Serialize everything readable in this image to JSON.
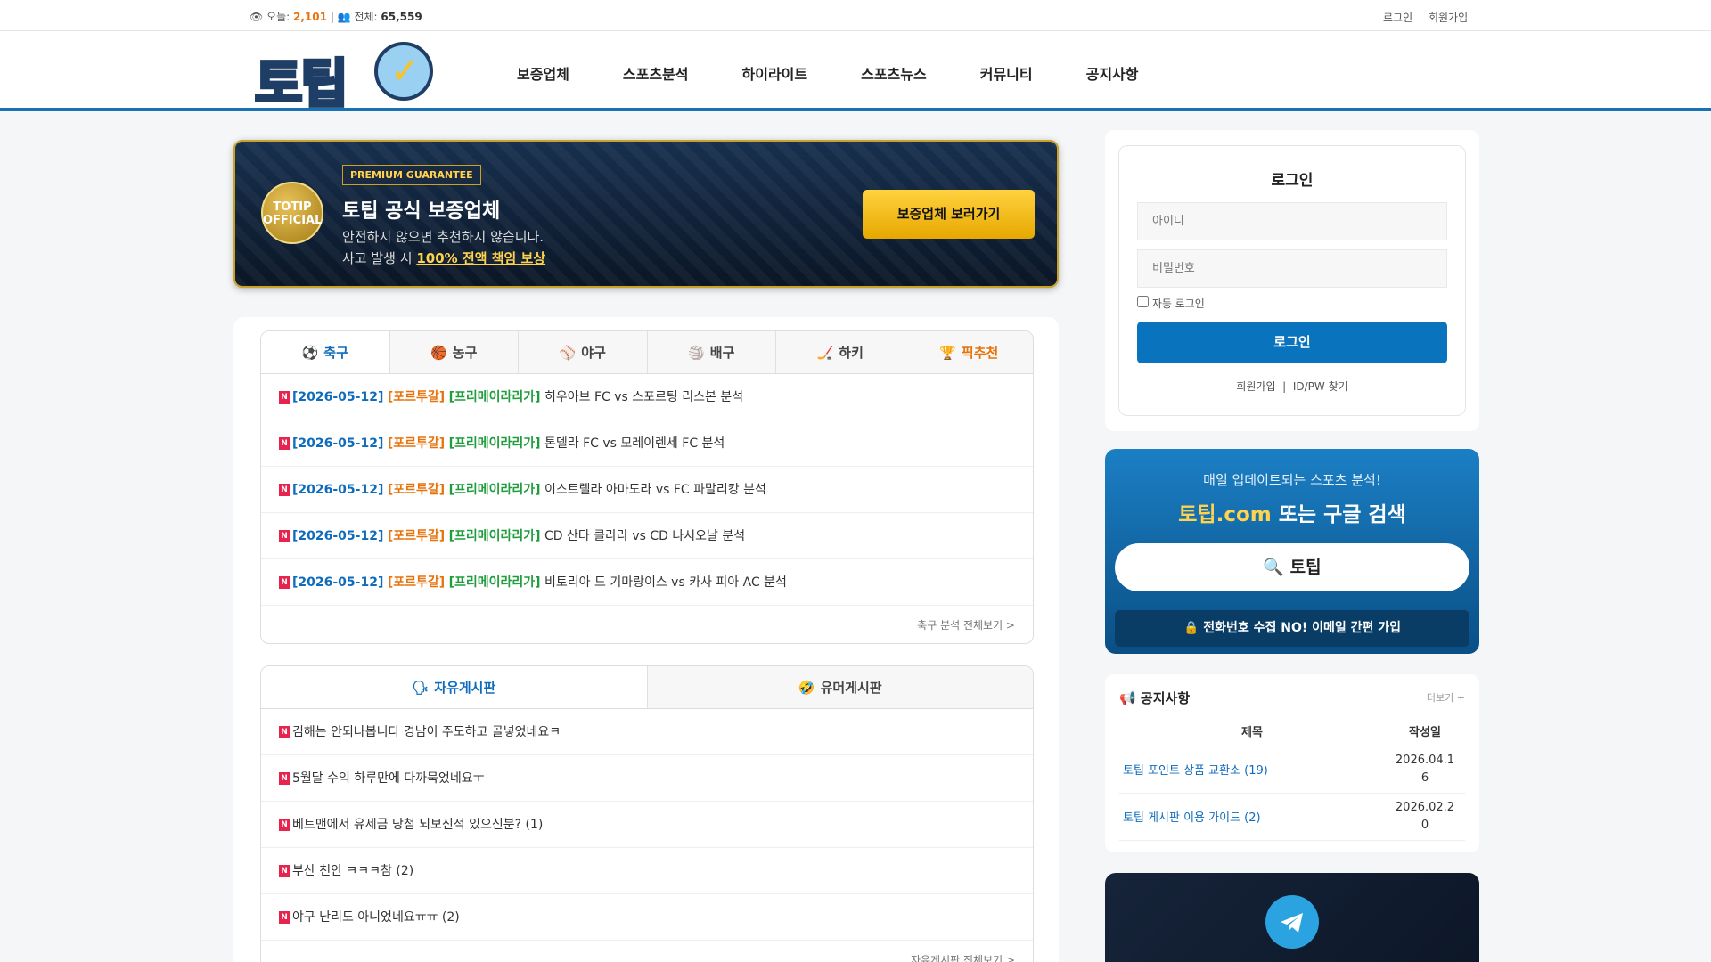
{
  "topbar": {
    "today_label": "오늘:",
    "today_count": "2,101",
    "separator": "|",
    "total_label": "전체:",
    "total_count": "65,559",
    "login": "로그인",
    "signup": "회원가입"
  },
  "logo": {
    "text": "토팁",
    "check": "✓"
  },
  "nav": [
    "보증업체",
    "스포츠분석",
    "하이라이트",
    "스포츠뉴스",
    "커뮤니티",
    "공지사항"
  ],
  "banner": {
    "seal_line1": "TOTIP",
    "seal_line2": "OFFICIAL",
    "tag": "PREMIUM GUARANTEE",
    "title": "토팁 공식 보증업체",
    "sub1": "안전하지 않으면 추천하지 않습니다.",
    "sub2_prefix": "사고 발생 시",
    "sub2_highlight": "100% 전액 책임 보상",
    "button": "보증업체 보러가기"
  },
  "sports_tabs": [
    {
      "icon": "⚽",
      "label": "축구"
    },
    {
      "icon": "🏀",
      "label": "농구"
    },
    {
      "icon": "⚾",
      "label": "야구"
    },
    {
      "icon": "🏐",
      "label": "배구"
    },
    {
      "icon": "🏒",
      "label": "하키"
    },
    {
      "icon": "🏆",
      "label": "픽추천"
    }
  ],
  "analysis_rows": [
    {
      "date": "[2026-05-12]",
      "country": "[포르투갈]",
      "league": "[프리메이라리가]",
      "title": "히우아브 FC vs 스포르팅 리스본 분석"
    },
    {
      "date": "[2026-05-12]",
      "country": "[포르투갈]",
      "league": "[프리메이라리가]",
      "title": "톤델라 FC vs 모레이렌세 FC 분석"
    },
    {
      "date": "[2026-05-12]",
      "country": "[포르투갈]",
      "league": "[프리메이라리가]",
      "title": "이스트렐라 아마도라 vs FC 파말리캉 분석"
    },
    {
      "date": "[2026-05-12]",
      "country": "[포르투갈]",
      "league": "[프리메이라리가]",
      "title": "CD 산타 클라라 vs CD 나시오날 분석"
    },
    {
      "date": "[2026-05-12]",
      "country": "[포르투갈]",
      "league": "[프리메이라리가]",
      "title": "비토리아 드 기마랑이스 vs 카사 피아 AC 분석"
    }
  ],
  "analysis_more": "축구 분석 전체보기 >",
  "board_tabs": [
    {
      "icon": "🗣",
      "label": "자유게시판"
    },
    {
      "icon": "🤣",
      "label": "유머게시판"
    }
  ],
  "board_rows": [
    "김해는 안되나봅니다 경남이 주도하고 골넣었네요ㅋ",
    "5월달 수익 하루만에 다까묵었네요ㅜ",
    "베트맨에서 유세금 당첨 되보신적 있으신분? (1)",
    "부산 천안 ㅋㅋㅋ참 (2)",
    "야구 난리도 아니었네요ㅠㅠ (2)"
  ],
  "board_more": "자유게시판 전체보기 >",
  "new_badge": "N",
  "login_box": {
    "title": "로그인",
    "id_placeholder": "아이디",
    "pw_placeholder": "비밀번호",
    "auto_login": "자동 로그인",
    "button": "로그인",
    "signup": "회원가입",
    "divider": "|",
    "find": "ID/PW 찾기"
  },
  "promo": {
    "line1": "매일 업데이트되는 스포츠 분석!",
    "domain": "토팁.com",
    "line2_rest": "또는 구글 검색",
    "search_icon": "🔍",
    "search_text": "토팁",
    "join_icon": "🔒",
    "join_text": "전화번호 수집 NO! 이메일 간편 가입"
  },
  "notice": {
    "icon": "📢",
    "title": "공지사항",
    "more": "더보기 +",
    "col_title": "제목",
    "col_date": "작성일",
    "rows": [
      {
        "title": "토팁 포인트 상품 교환소 (19)",
        "date_l1": "2026.04.1",
        "date_l2": "6"
      },
      {
        "title": "토팁 게시판 이용 가이드 (2)",
        "date_l1": "2026.02.2",
        "date_l2": "0"
      }
    ]
  },
  "colors": {
    "primary": "#0a73bd",
    "accent": "#e8730c",
    "gold": "#ffd34d",
    "league": "#1f9d3c",
    "new": "#e6244e"
  }
}
